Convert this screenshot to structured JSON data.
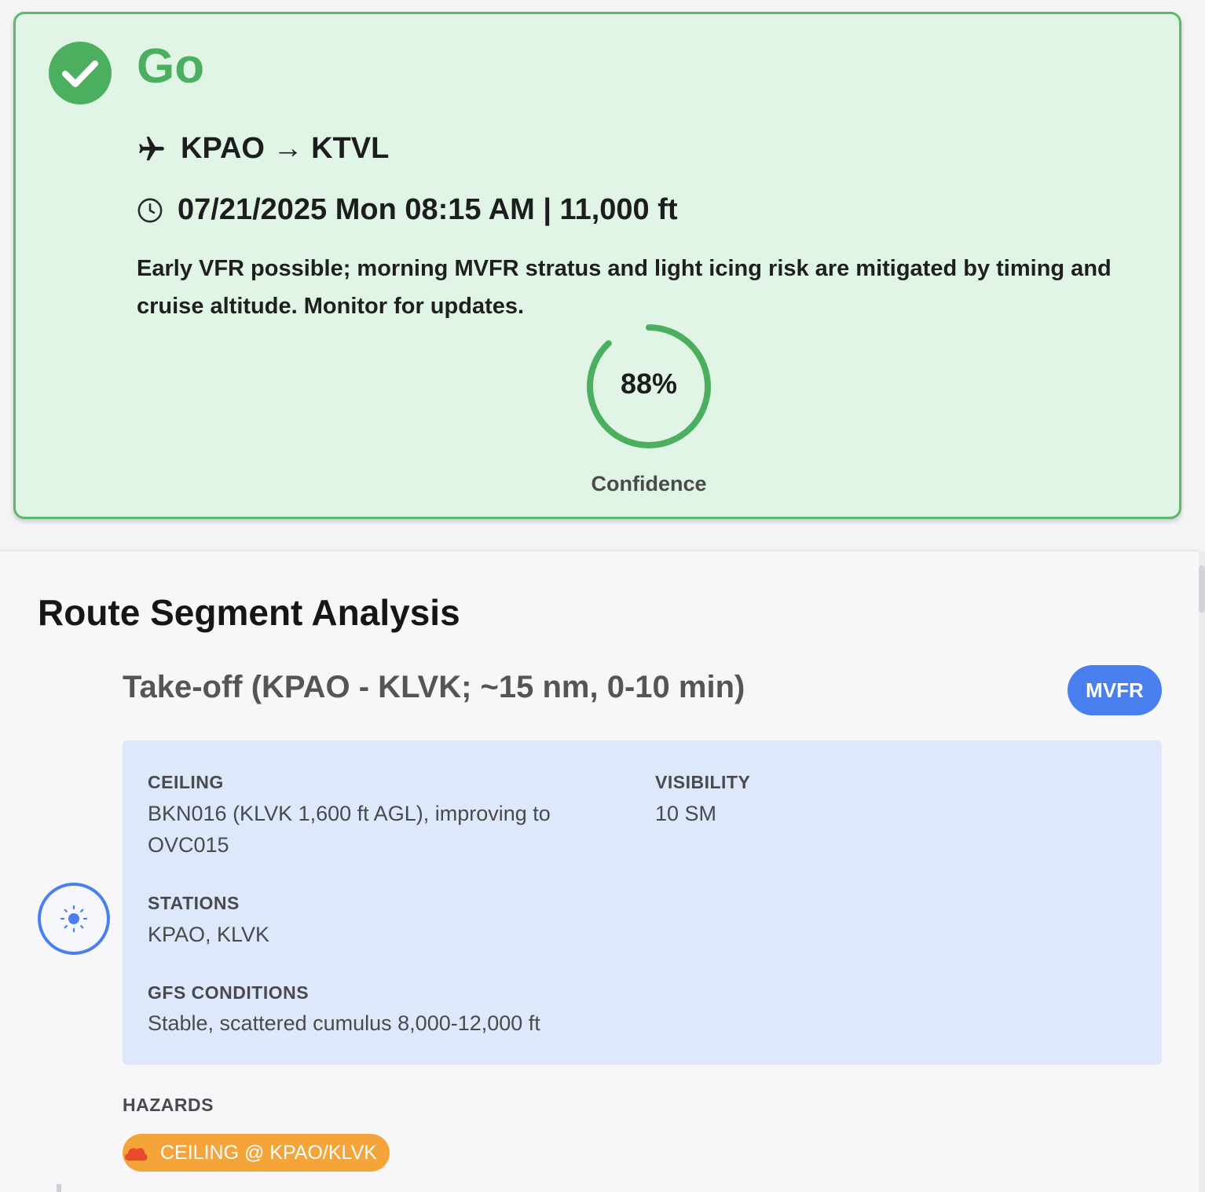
{
  "decision": {
    "verdict": "Go",
    "route": "KPAO → KTVL",
    "datetime_altitude": "07/21/2025 Mon 08:15 AM | 11,000 ft",
    "summary": "Early VFR possible; morning MVFR stratus and light icing risk are mitigated by timing and cruise altitude. Monitor for updates.",
    "confidence_display": "88%",
    "confidence_value": 0.88,
    "confidence_label": "Confidence",
    "colors": {
      "accent": "#4caf5f",
      "card_background": "#e1f5e6",
      "card_border": "#5cb86a"
    },
    "icons": {
      "verdict": "check-circle-icon",
      "route": "airplane-icon",
      "time": "clock-icon"
    }
  },
  "route_segment_analysis": {
    "title": "Route Segment Analysis",
    "segments": [
      {
        "title": "Take-off (KPAO - KLVK; ~15 nm, 0-10 min)",
        "flight_category": "MVFR",
        "flight_category_color": "#4a7ff0",
        "marker_icon": "sun-icon",
        "details": {
          "ceiling_label": "CEILING",
          "ceiling_value": "BKN016 (KLVK 1,600 ft AGL), improving to OVC015",
          "visibility_label": "VISIBILITY",
          "visibility_value": "10 SM",
          "stations_label": "STATIONS",
          "stations_value": "KPAO, KLVK",
          "gfs_label": "GFS CONDITIONS",
          "gfs_value": "Stable, scattered cumulus 8,000-12,000 ft"
        },
        "hazards_label": "HAZARDS",
        "hazards": [
          {
            "text": "CEILING @ KPAO/KLVK",
            "icon": "cloud-icon",
            "color": "#f5a43a"
          }
        ]
      }
    ]
  }
}
